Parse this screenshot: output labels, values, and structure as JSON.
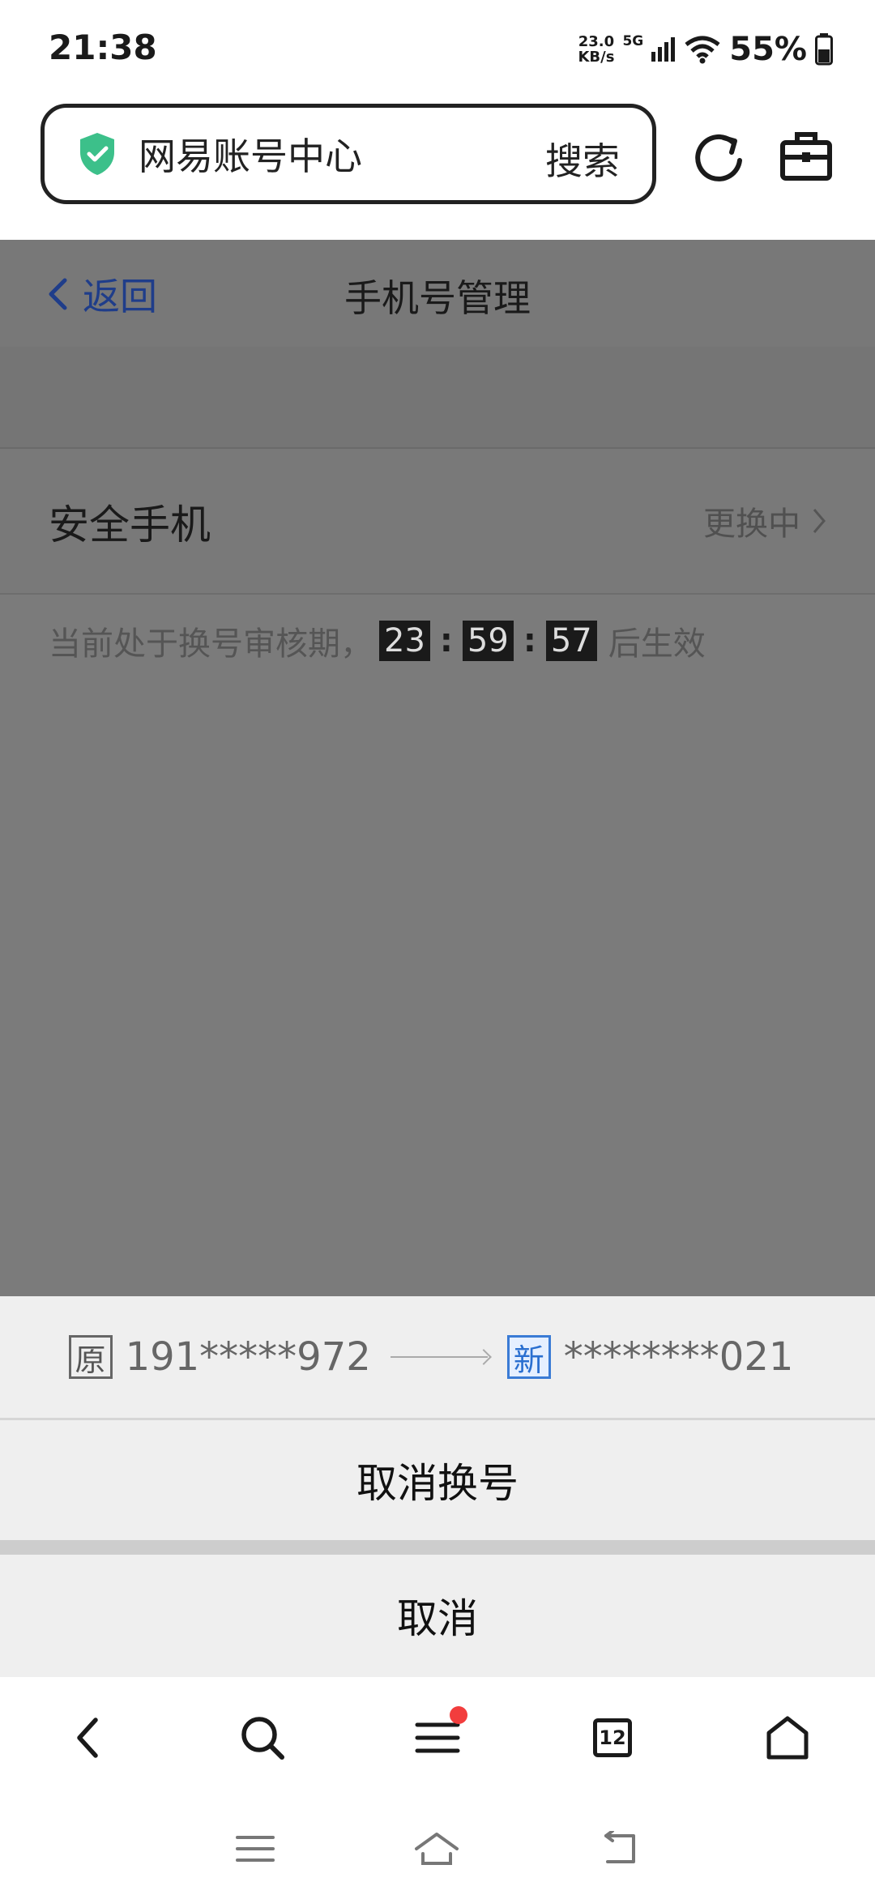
{
  "status": {
    "time": "21:38",
    "net_speed_value": "23.0",
    "net_speed_unit": "KB/s",
    "network": "5G",
    "battery": "55%"
  },
  "address_bar": {
    "security_icon": "shield-check-icon",
    "title": "网易账号中心",
    "search_label": "搜索"
  },
  "header": {
    "back_label": "返回",
    "title": "手机号管理"
  },
  "security_phone": {
    "label": "安全手机",
    "status": "更换中"
  },
  "notice": {
    "prefix": "当前处于换号审核期，",
    "hours": "23",
    "minutes": "59",
    "seconds": "57",
    "suffix": "后生效"
  },
  "sheet": {
    "old_tag": "原",
    "old_number": "191*****972",
    "new_tag": "新",
    "new_number": "********021",
    "cancel_change_label": "取消换号",
    "cancel_label": "取消"
  },
  "bottom_nav": {
    "tab_count": "12"
  },
  "colors": {
    "accent": "#1f3d8a",
    "shield": "#3cc08a",
    "badge_dot": "#f23d3d",
    "overlay": "#7b7b7b"
  }
}
